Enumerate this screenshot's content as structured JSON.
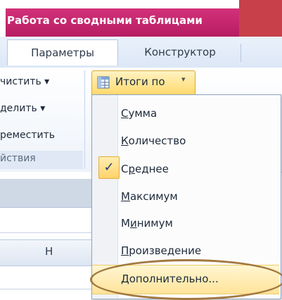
{
  "ribbon": {
    "context_title": "Работа со сводными таблицами",
    "tabs": [
      "Параметры",
      "Конструктор"
    ],
    "left_commands": [
      "чистить ▾",
      "делить ▾",
      "реместить"
    ],
    "group_label": "йствия",
    "totals_button": {
      "label": "Итоги по",
      "caret": "▾",
      "icon": "pivot-table-icon"
    }
  },
  "menu": {
    "items": [
      {
        "pre": "",
        "key": "С",
        "post": "умма",
        "checked": false
      },
      {
        "pre": "",
        "key": "К",
        "post": "оличество",
        "checked": false
      },
      {
        "pre": "С",
        "key": "р",
        "post": "еднее",
        "checked": true
      },
      {
        "pre": "",
        "key": "М",
        "post": "аксимум",
        "checked": false
      },
      {
        "pre": "М",
        "key": "и",
        "post": "нимум",
        "checked": false
      },
      {
        "pre": "",
        "key": "П",
        "post": "роизведение",
        "checked": false
      },
      {
        "pre": "",
        "key": "Д",
        "post": "ополнительно...",
        "checked": false,
        "highlighted": true
      }
    ],
    "check_symbol": "✓"
  },
  "grid": {
    "column_header": "H"
  },
  "colors": {
    "context_header": "#c1266d",
    "hover": "#ffe39a",
    "annotation": "#a2783f"
  }
}
